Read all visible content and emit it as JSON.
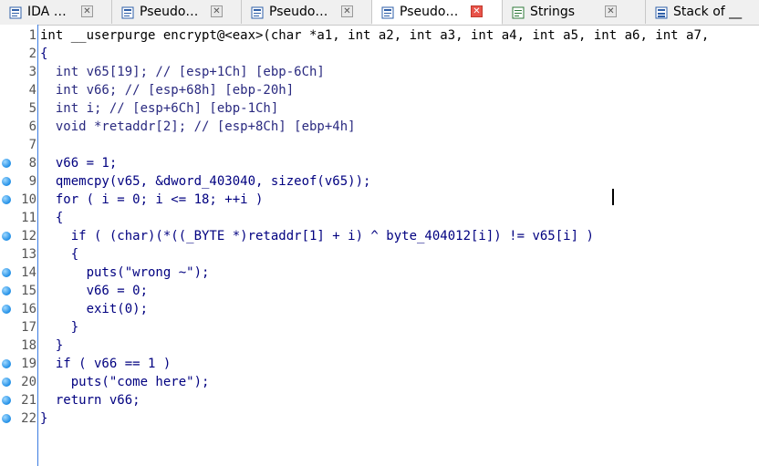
{
  "tabs": [
    {
      "label": "IDA …",
      "icon": "ida-view-icon",
      "active": false
    },
    {
      "label": "Pseudo…",
      "icon": "pseudocode-icon",
      "active": false
    },
    {
      "label": "Pseudo…",
      "icon": "pseudocode-icon",
      "active": false
    },
    {
      "label": "Pseudo…",
      "icon": "pseudocode-icon",
      "active": true
    },
    {
      "label": "Strings",
      "icon": "strings-icon",
      "active": false
    },
    {
      "label": "Stack of __",
      "icon": "stack-icon",
      "active": false
    }
  ],
  "code_lines": [
    {
      "n": "1",
      "bp": false,
      "text": "int __userpurge encrypt@<eax>(char *a1, int a2, int a3, int a4, int a5, int a6, int a7,"
    },
    {
      "n": "2",
      "bp": false,
      "text": "{"
    },
    {
      "n": "3",
      "bp": false,
      "text": "  int v65[19]; // [esp+1Ch] [ebp-6Ch]"
    },
    {
      "n": "4",
      "bp": false,
      "text": "  int v66; // [esp+68h] [ebp-20h]"
    },
    {
      "n": "5",
      "bp": false,
      "text": "  int i; // [esp+6Ch] [ebp-1Ch]"
    },
    {
      "n": "6",
      "bp": false,
      "text": "  void *retaddr[2]; // [esp+8Ch] [ebp+4h]"
    },
    {
      "n": "7",
      "bp": false,
      "text": ""
    },
    {
      "n": "8",
      "bp": true,
      "text": "  v66 = 1;"
    },
    {
      "n": "9",
      "bp": true,
      "text": "  qmemcpy(v65, &dword_403040, sizeof(v65));"
    },
    {
      "n": "10",
      "bp": true,
      "text": "  for ( i = 0; i <= 18; ++i )"
    },
    {
      "n": "11",
      "bp": false,
      "text": "  {"
    },
    {
      "n": "12",
      "bp": true,
      "text": "    if ( (char)(*((_BYTE *)retaddr[1] + i) ^ byte_404012[i]) != v65[i] )"
    },
    {
      "n": "13",
      "bp": false,
      "text": "    {"
    },
    {
      "n": "14",
      "bp": true,
      "text": "      puts(\"wrong ~\");"
    },
    {
      "n": "15",
      "bp": true,
      "text": "      v66 = 0;"
    },
    {
      "n": "16",
      "bp": true,
      "text": "      exit(0);"
    },
    {
      "n": "17",
      "bp": false,
      "text": "    }"
    },
    {
      "n": "18",
      "bp": false,
      "text": "  }"
    },
    {
      "n": "19",
      "bp": true,
      "text": "  if ( v66 == 1 )"
    },
    {
      "n": "20",
      "bp": true,
      "text": "    puts(\"come here\");"
    },
    {
      "n": "21",
      "bp": true,
      "text": "  return v66;"
    },
    {
      "n": "22",
      "bp": true,
      "text": "}"
    }
  ]
}
